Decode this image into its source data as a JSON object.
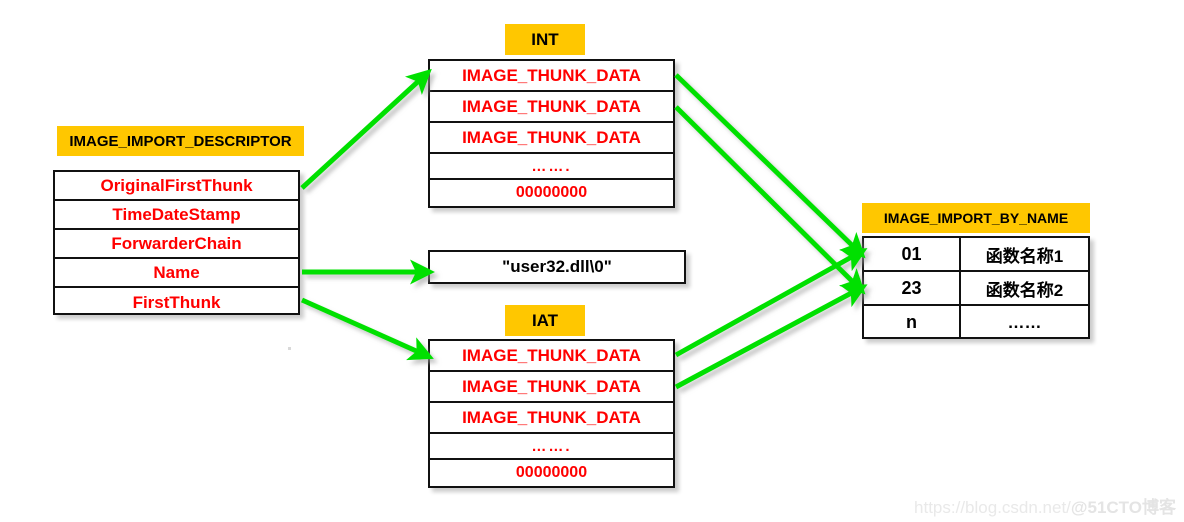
{
  "diagram": {
    "title_descriptor": "IMAGE_IMPORT_DESCRIPTOR",
    "title_int": "INT",
    "title_iat": "IAT",
    "title_import_by_name": "IMAGE_IMPORT_BY_NAME"
  },
  "descriptor": {
    "label": "IMAGE_IMPORT_DESCRIPTOR",
    "fields": [
      {
        "name": "OriginalFirstThunk"
      },
      {
        "name": "TimeDateStamp"
      },
      {
        "name": "ForwarderChain"
      },
      {
        "name": "Name"
      },
      {
        "name": "FirstThunk"
      }
    ]
  },
  "int_table": {
    "label": "INT",
    "rows": [
      {
        "text": "IMAGE_THUNK_DATA"
      },
      {
        "text": "IMAGE_THUNK_DATA"
      },
      {
        "text": "IMAGE_THUNK_DATA"
      },
      {
        "text": "……."
      },
      {
        "text": "00000000"
      }
    ]
  },
  "iat_table": {
    "label": "IAT",
    "rows": [
      {
        "text": "IMAGE_THUNK_DATA"
      },
      {
        "text": "IMAGE_THUNK_DATA"
      },
      {
        "text": "IMAGE_THUNK_DATA"
      },
      {
        "text": "……."
      },
      {
        "text": "00000000"
      }
    ]
  },
  "dll_name": {
    "text": "\"user32.dll\\0\""
  },
  "import_by_name": {
    "label": "IMAGE_IMPORT_BY_NAME",
    "rows": [
      {
        "ordinal": "01",
        "function_name": "函数名称1"
      },
      {
        "ordinal": "23",
        "function_name": "函数名称2"
      },
      {
        "ordinal": "n",
        "function_name": "……"
      }
    ]
  },
  "watermark": {
    "url": "https://blog.csdn.net/",
    "site": "@51CTO博客"
  },
  "colors": {
    "badge_yellow": "#FFC700",
    "field_text_red": "#FF0000",
    "arrow_green": "#00E000",
    "border_black": "#111111"
  }
}
